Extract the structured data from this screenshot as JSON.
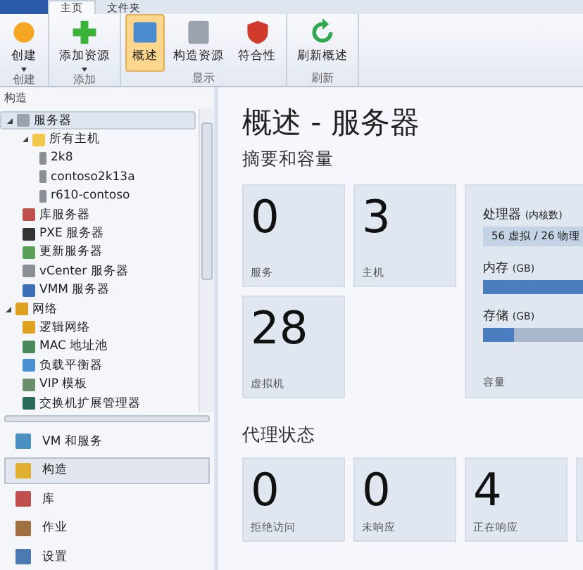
{
  "tabs": [
    {
      "label": "主页",
      "selected": true
    },
    {
      "label": "文件夹",
      "selected": false
    }
  ],
  "ribbon_groups": [
    {
      "label": "创建",
      "buttons": [
        {
          "label": "创建",
          "dropdown": true,
          "selected": false
        }
      ]
    },
    {
      "label": "添加",
      "buttons": [
        {
          "label": "添加资源",
          "dropdown": true,
          "selected": false
        }
      ]
    },
    {
      "label": "显示",
      "buttons": [
        {
          "label": "概述",
          "dropdown": false,
          "selected": true
        },
        {
          "label": "构造资源",
          "dropdown": false,
          "selected": false
        },
        {
          "label": "符合性",
          "dropdown": false,
          "selected": false
        }
      ]
    },
    {
      "label": "刷新",
      "buttons": [
        {
          "label": "刷新概述",
          "dropdown": false,
          "selected": false
        }
      ]
    }
  ],
  "sidebar": {
    "title": "构造",
    "tree": [
      {
        "label": "服务器",
        "expanded": true,
        "selected": true,
        "children": [
          {
            "label": "所有主机",
            "expanded": true,
            "selected": false,
            "children": [
              {
                "label": "2k8",
                "selected": false
              },
              {
                "label": "contoso2k13a",
                "selected": false
              },
              {
                "label": "r610-contoso",
                "selected": false
              }
            ]
          },
          {
            "label": "库服务器",
            "selected": false
          },
          {
            "label": "PXE 服务器",
            "selected": false
          },
          {
            "label": "更新服务器",
            "selected": false
          },
          {
            "label": "vCenter 服务器",
            "selected": false
          },
          {
            "label": "VMM 服务器",
            "selected": false
          }
        ]
      },
      {
        "label": "网络",
        "expanded": true,
        "selected": false,
        "children": [
          {
            "label": "逻辑网络",
            "selected": false
          },
          {
            "label": "MAC 地址池",
            "selected": false
          },
          {
            "label": "负载平衡器",
            "selected": false
          },
          {
            "label": "VIP 模板",
            "selected": false
          },
          {
            "label": "交换机扩展管理器",
            "selected": false
          }
        ]
      }
    ],
    "nav": [
      {
        "label": "VM 和服务",
        "selected": false
      },
      {
        "label": "构造",
        "selected": true
      },
      {
        "label": "库",
        "selected": false
      },
      {
        "label": "作业",
        "selected": false
      },
      {
        "label": "设置",
        "selected": false
      }
    ]
  },
  "main": {
    "title": "概述 - 服务器",
    "summary": {
      "heading": "摘要和容量",
      "tiles": [
        {
          "value": "0",
          "label": "服务"
        },
        {
          "value": "3",
          "label": "主机"
        },
        {
          "value": "28",
          "label": "虚拟机"
        }
      ],
      "capacity": {
        "label": "容量",
        "meters": [
          {
            "name": "处理器",
            "unit": "(内核数)",
            "reading": "56 虚拟 / 26 物理"
          },
          {
            "name": "内存",
            "unit": "(GB)",
            "level": 1
          },
          {
            "name": "存储",
            "unit": "(GB)",
            "level": 0.12
          }
        ]
      }
    },
    "agent": {
      "heading": "代理状态",
      "tiles": [
        {
          "value": "0",
          "label": "拒绝访问"
        },
        {
          "value": "0",
          "label": "未响应"
        },
        {
          "value": "4",
          "label": "正在响应"
        }
      ]
    }
  }
}
